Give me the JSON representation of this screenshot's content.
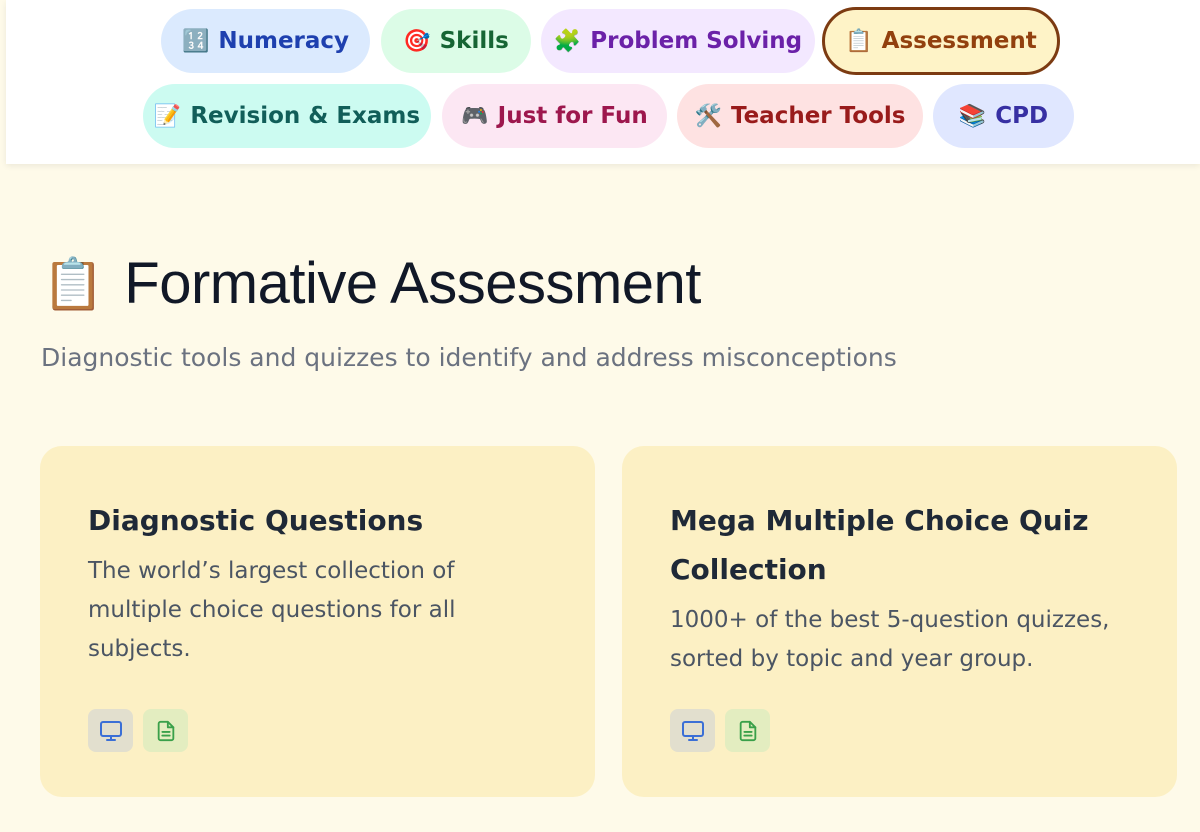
{
  "nav": {
    "pills": [
      {
        "icon": "🔢",
        "label": "Numeracy"
      },
      {
        "icon": "🎯",
        "label": "Skills"
      },
      {
        "icon": "🧩",
        "label": "Problem Solving"
      },
      {
        "icon": "📋",
        "label": "Assessment"
      },
      {
        "icon": "📝",
        "label": "Revision & Exams"
      },
      {
        "icon": "🎮",
        "label": "Just for Fun"
      },
      {
        "icon": "🛠️",
        "label": "Teacher Tools"
      },
      {
        "icon": "📚",
        "label": "CPD"
      }
    ],
    "active": "Assessment"
  },
  "section": {
    "icon": "📋",
    "title": "Formative Assessment",
    "subtitle": "Diagnostic tools and quizzes to identify and address misconceptions"
  },
  "cards": [
    {
      "title": "Diagnostic Questions",
      "description": "The world’s largest collection of multiple choice questions for all subjects.",
      "badges": [
        "monitor-icon",
        "document-icon"
      ]
    },
    {
      "title": "Mega Multiple Choice Quiz Collection",
      "description": "1000+ of the best 5-question quizzes, sorted by topic and year group.",
      "badges": [
        "monitor-icon",
        "document-icon"
      ]
    }
  ],
  "colors": {
    "page_bg": "#fefae9",
    "card_bg": "#fcf0c4",
    "active_border": "#7c3b12",
    "monitor_icon": "#3b6fd6",
    "document_icon": "#3aa04a"
  }
}
